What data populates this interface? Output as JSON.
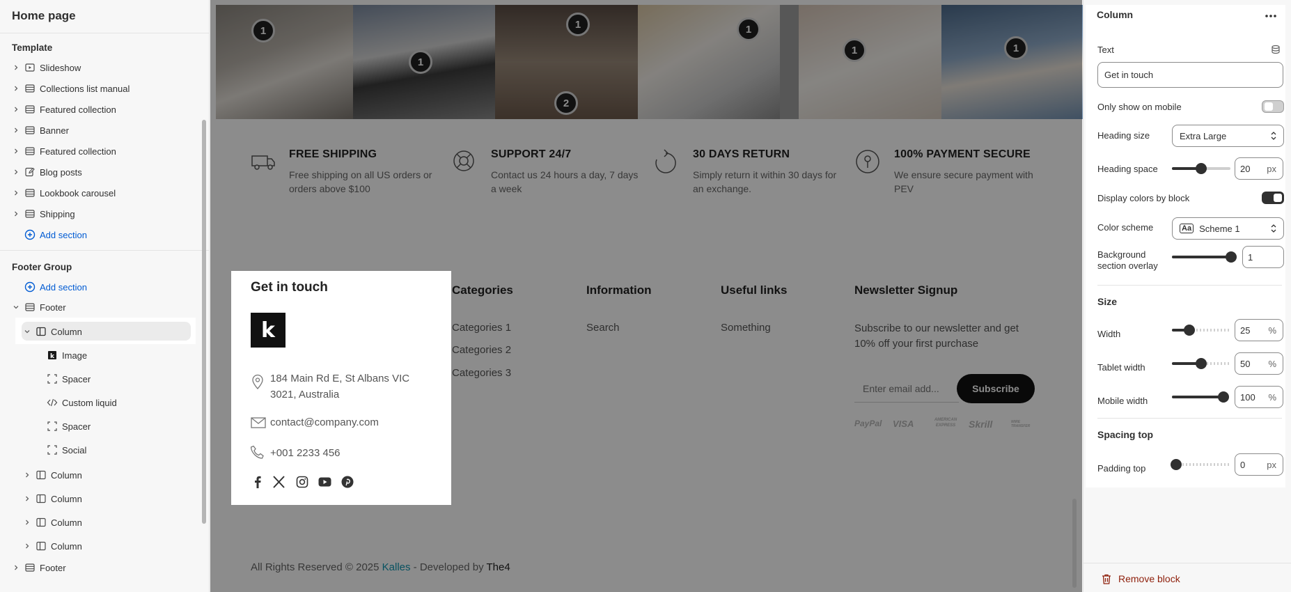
{
  "sidebar": {
    "page_title": "Home page",
    "template_label": "Template",
    "template_items": [
      {
        "label": "Slideshow",
        "icon": "slideshow-icon"
      },
      {
        "label": "Collections list manual",
        "icon": "section-icon"
      },
      {
        "label": "Featured collection",
        "icon": "section-icon"
      },
      {
        "label": "Banner",
        "icon": "section-icon"
      },
      {
        "label": "Featured collection",
        "icon": "section-icon"
      },
      {
        "label": "Blog posts",
        "icon": "blog-icon"
      },
      {
        "label": "Lookbook carousel",
        "icon": "section-icon"
      },
      {
        "label": "Shipping",
        "icon": "section-icon"
      }
    ],
    "add_section": "Add section",
    "footer_group_label": "Footer Group",
    "footer_label": "Footer",
    "column_label": "Column",
    "column_blocks": [
      "Image",
      "Spacer",
      "Custom liquid",
      "Spacer",
      "Social"
    ],
    "other_columns": [
      "Column",
      "Column",
      "Column",
      "Column"
    ],
    "footer2_label": "Footer"
  },
  "preview": {
    "hotspots": [
      "1",
      "1",
      "1",
      "2",
      "1",
      "1",
      "1"
    ],
    "features": [
      {
        "title": "FREE SHIPPING",
        "text": "Free shipping on all US orders or orders above $100"
      },
      {
        "title": "SUPPORT 24/7",
        "text": "Contact us 24 hours a day, 7 days a week"
      },
      {
        "title": "30 DAYS RETURN",
        "text": "Simply return it within 30 days for an exchange."
      },
      {
        "title": "100% PAYMENT SECURE",
        "text": "We ensure secure payment with PEV"
      }
    ],
    "contact": {
      "title": "Get in touch",
      "logo_letter": "k",
      "address": "184 Main Rd E, St Albans VIC 3021, Australia",
      "email": "contact@company.com",
      "phone": "+001 2233 456"
    },
    "columns": [
      {
        "title": "Categories",
        "links": [
          "Categories 1",
          "Categories 2",
          "Categories 3"
        ]
      },
      {
        "title": "Information",
        "links": [
          "Search"
        ]
      },
      {
        "title": "Useful links",
        "links": [
          "Something"
        ]
      }
    ],
    "newsletter": {
      "title": "Newsletter Signup",
      "text": "Subscribe to our newsletter and get 10% off your first purchase",
      "placeholder": "Enter email add...",
      "button": "Subscribe"
    },
    "payment_logos": [
      "PayPal",
      "VISA",
      "AMERICAN EXPRESS",
      "Skrill",
      "WIRE TRANSFER"
    ],
    "copyright_prefix": "All Rights Reserved © 2025 ",
    "copyright_brand": "Kalles",
    "copyright_mid": " - Developed by ",
    "copyright_dev": "The4",
    "brand_color": "#0e94b0"
  },
  "panel": {
    "title": "Column",
    "text_label": "Text",
    "text_value": "Get in touch",
    "only_mobile_label": "Only show on mobile",
    "only_mobile_on": false,
    "heading_size_label": "Heading size",
    "heading_size_value": "Extra Large",
    "heading_space_label": "Heading space",
    "heading_space_value": "20",
    "heading_space_unit": "px",
    "display_colors_label": "Display colors by block",
    "display_colors_on": true,
    "color_scheme_label": "Color scheme",
    "color_scheme_value": "Scheme 1",
    "color_scheme_icon": "Aa",
    "bg_overlay_label": "Background section overlay",
    "bg_overlay_value": "1",
    "size_section": "Size",
    "width_label": "Width",
    "width_value": "25",
    "tablet_width_label": "Tablet width",
    "tablet_width_value": "50",
    "mobile_width_label": "Mobile width",
    "mobile_width_value": "100",
    "percent_unit": "%",
    "spacing_top_section": "Spacing top",
    "padding_top_label": "Padding top",
    "padding_top_value": "0",
    "padding_top_unit": "px",
    "remove_block": "Remove block",
    "danger_color": "#8e1f0b"
  }
}
